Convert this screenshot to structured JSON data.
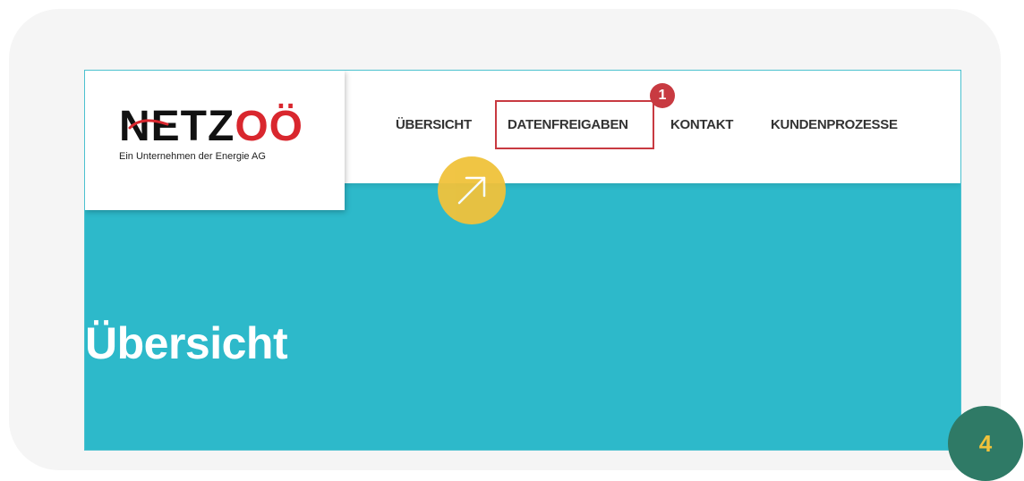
{
  "logo": {
    "brand_main": "NETZ",
    "brand_accent": "OÖ",
    "tagline": "Ein Unternehmen der Energie AG"
  },
  "nav": {
    "items": [
      {
        "label": "ÜBERSICHT"
      },
      {
        "label": "DATENFREIGABEN"
      },
      {
        "label": "KONTAKT"
      },
      {
        "label": "KUNDENPROZESSE"
      }
    ]
  },
  "annotation": {
    "highlight_badge": "1",
    "step_number": "4"
  },
  "hero": {
    "title": "Übersicht"
  },
  "colors": {
    "accent_teal": "#2db9ca",
    "brand_red": "#d9272e",
    "highlight_red": "#c83a41",
    "pointer_yellow": "#f0c23b",
    "step_green": "#2f7a66"
  }
}
